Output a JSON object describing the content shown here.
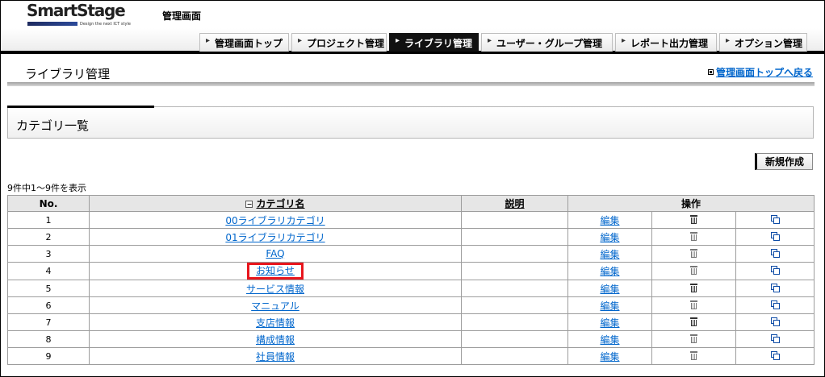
{
  "brand": {
    "logo_text": "SmartStage",
    "logo_tagline": "Design the next ICT style"
  },
  "header": {
    "admin_title": "管理画面"
  },
  "nav": {
    "tabs": [
      {
        "label": "管理画面トップ"
      },
      {
        "label": "プロジェクト管理"
      },
      {
        "label": "ライブラリ管理",
        "active": true
      },
      {
        "label": "ユーザー・グループ管理"
      },
      {
        "label": "レポート出力管理"
      },
      {
        "label": "オプション管理"
      }
    ]
  },
  "page": {
    "title": "ライブラリ管理",
    "back_link": "管理画面トップへ戻る"
  },
  "category_panel": {
    "title": "カテゴリ一覧"
  },
  "actions": {
    "create_label": "新規作成"
  },
  "list": {
    "count_text": "9件中1～9件を表示",
    "headers": {
      "no": "No.",
      "name": "カテゴリ名",
      "description": "説明",
      "operations": "操作"
    },
    "edit_label": "編集",
    "rows": [
      {
        "no": "1",
        "name": "00ライブラリカテゴリ",
        "description": ""
      },
      {
        "no": "2",
        "name": "01ライブラリカテゴリ",
        "description": ""
      },
      {
        "no": "3",
        "name": "FAQ",
        "description": ""
      },
      {
        "no": "4",
        "name": "お知らせ",
        "description": "",
        "highlighted": true
      },
      {
        "no": "5",
        "name": "サービス情報",
        "description": ""
      },
      {
        "no": "6",
        "name": "マニュアル",
        "description": ""
      },
      {
        "no": "7",
        "name": "支店情報",
        "description": ""
      },
      {
        "no": "8",
        "name": "構成情報",
        "description": ""
      },
      {
        "no": "9",
        "name": "社員情報",
        "description": ""
      }
    ]
  },
  "icons": {
    "sort": "sort-toggle-icon",
    "delete": "trash-icon",
    "copy": "copy-icon",
    "back": "square-bullet-icon"
  },
  "colors": {
    "link": "#0066cc",
    "highlight": "#e8161d",
    "active_tab": "#111111"
  }
}
